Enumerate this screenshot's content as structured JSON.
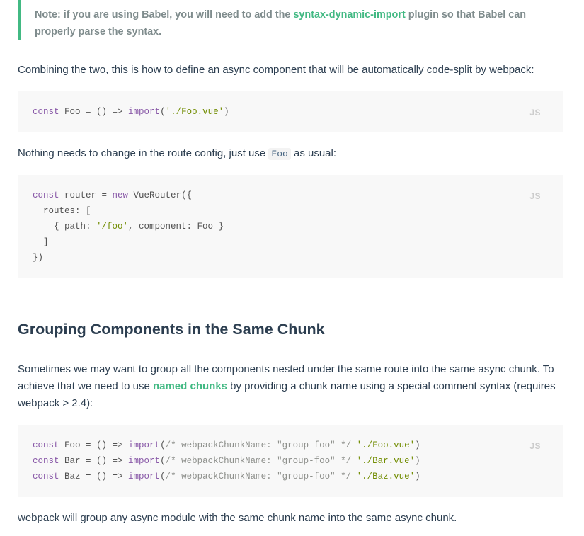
{
  "note": {
    "before": "Note: if you are using Babel, you will need to add the ",
    "link": "syntax-dynamic-import",
    "after": " plugin so that Babel can properly parse the syntax."
  },
  "para1": "Combining the two, this is how to define an async component that will be automatically code-split by webpack:",
  "code1": {
    "lang": "JS",
    "line1": {
      "kw": "const",
      "name": " Foo = () => ",
      "fn": "import",
      "open": "(",
      "str": "'./Foo.vue'",
      "close": ")"
    }
  },
  "para2": {
    "before": "Nothing needs to change in the route config, just use ",
    "code": "Foo",
    "after": " as usual:"
  },
  "code2": {
    "lang": "JS",
    "l1_kw": "const",
    "l1_mid": " router = ",
    "l1_new": "new",
    "l1_end": " VueRouter({",
    "l2": "  routes: [",
    "l3_a": "    { path: ",
    "l3_str": "'/foo'",
    "l3_b": ", component: Foo }",
    "l4": "  ]",
    "l5": "})"
  },
  "heading": "Grouping Components in the Same Chunk",
  "para3": {
    "before": "Sometimes we may want to group all the components nested under the same route into the same async chunk. To achieve that we need to use ",
    "link": "named chunks",
    "after": " by providing a chunk name using a special comment syntax (requires webpack > 2.4):"
  },
  "code3": {
    "lang": "JS",
    "lines": [
      {
        "kw": "const",
        "name": " Foo = () => ",
        "fn": "import",
        "open": "(",
        "cm": "/* webpackChunkName: \"group-foo\" */",
        "sp": " ",
        "str": "'./Foo.vue'",
        "close": ")"
      },
      {
        "kw": "const",
        "name": " Bar = () => ",
        "fn": "import",
        "open": "(",
        "cm": "/* webpackChunkName: \"group-foo\" */",
        "sp": " ",
        "str": "'./Bar.vue'",
        "close": ")"
      },
      {
        "kw": "const",
        "name": " Baz = () => ",
        "fn": "import",
        "open": "(",
        "cm": "/* webpackChunkName: \"group-foo\" */",
        "sp": " ",
        "str": "'./Baz.vue'",
        "close": ")"
      }
    ]
  },
  "para4": "webpack will group any async module with the same chunk name into the same async chunk."
}
